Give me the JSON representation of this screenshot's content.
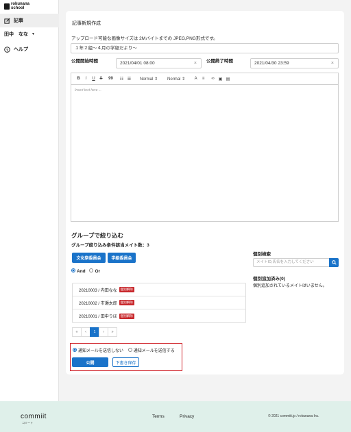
{
  "sidebar": {
    "logo_line1": "rokunana",
    "logo_line2": "school",
    "items": [
      {
        "label": "記事",
        "icon": "edit-icon"
      },
      {
        "label": "田中　なな",
        "icon": "chevron-down-icon"
      },
      {
        "label": "ヘルプ",
        "icon": "help-icon"
      }
    ]
  },
  "form": {
    "title": "記事新規作成",
    "upload_note": "アップロード可能な画像サイズは 2Mバイトまでの JPEG,PNG形式です。",
    "article_title": "１年２組〜４月の学級だより〜",
    "start_label": "公開開始時間",
    "start_value": "2021/04/01 08:00",
    "end_label": "公開終了時間",
    "end_value": "2021/04/30 23:59",
    "toolbar": {
      "bold": "B",
      "italic": "I",
      "underline": "U",
      "strike": "S",
      "quote": "99",
      "format1": "Normal",
      "format2": "Normal"
    },
    "editor_placeholder": "Insert text here ..."
  },
  "group": {
    "heading": "グループで絞り込む",
    "count_text": "グループ絞り込み条件該当メイト数：3",
    "buttons": [
      "文化祭委員会",
      "学級委員会"
    ],
    "and_label": "And",
    "or_label": "Or",
    "rows": [
      {
        "name": "20210003 / 内田なな",
        "tag": "個別解除"
      },
      {
        "name": "20210002 / 市瀬太郎",
        "tag": "個別解除"
      },
      {
        "name": "20210001 / 田中りほ",
        "tag": "個別解除"
      }
    ],
    "pager": [
      "«",
      "‹",
      "1",
      "›",
      "»"
    ]
  },
  "individual": {
    "heading": "個別検索",
    "placeholder": "メイトID,氏名を入力してください",
    "added_label": "個別追加済み(0)",
    "empty_text": "個別追加されているメイトはいません。"
  },
  "actions": {
    "mail_no": "通知メールを送信しない",
    "mail_yes": "通知メールを送信する",
    "publish": "公開",
    "draft": "下書き保存"
  },
  "footer": {
    "brand": "commiit",
    "brand_sub": "コミート",
    "terms": "Terms",
    "privacy": "Privacy",
    "copyright": "© 2021 commiit.jp / rokunana Inc."
  }
}
